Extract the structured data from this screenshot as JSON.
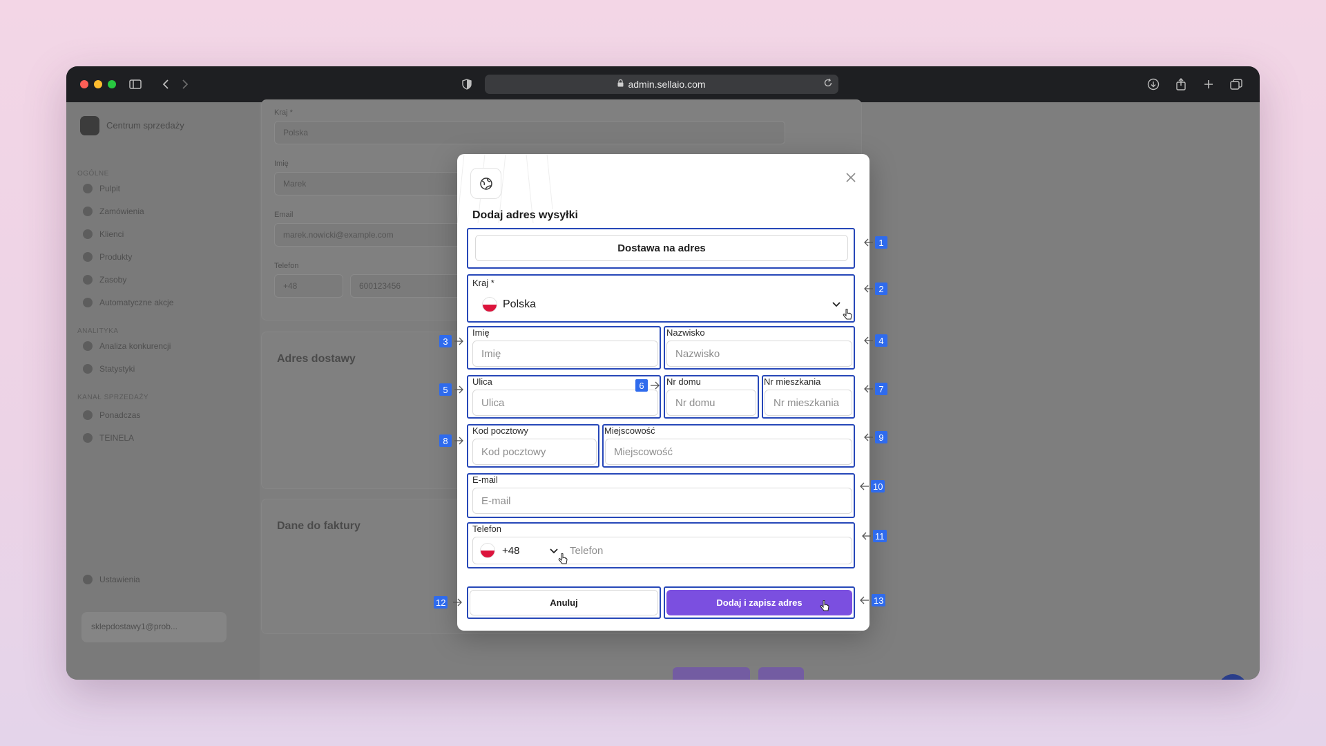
{
  "browser": {
    "url": "admin.sellaio.com"
  },
  "background_app": {
    "brand": "Centrum sprzedaży",
    "sections": [
      "OGÓLNE",
      "ANALITYKA",
      "KANAŁ SPRZEDAŻY"
    ],
    "nav": [
      "Pulpit",
      "Zamówienia",
      "Klienci",
      "Produkty",
      "Zasoby",
      "Automatyczne akcje",
      "Analiza konkurencji",
      "Statystyki",
      "Ponadczas",
      "TEINELA"
    ],
    "settings": "Ustawienia",
    "user_email": "sklepdostawy1@prob...",
    "fields": {
      "country_label": "Kraj *",
      "country_value": "Polska",
      "name_label": "Imię",
      "name_value": "Marek",
      "email_label": "Email",
      "email_value": "marek.nowicki@example.com",
      "phone_label": "Telefon",
      "phone_prefix": "+48",
      "phone_value": "600123456"
    },
    "headings": {
      "delivery_address": "Adres dostawy",
      "invoice_data": "Dane do faktury"
    }
  },
  "modal": {
    "title": "Dodaj adres wysyłki",
    "delivery_option": "Dostawa na adres",
    "country": {
      "label": "Kraj *",
      "value": "Polska"
    },
    "first_name": {
      "label": "Imię",
      "placeholder": "Imię"
    },
    "last_name": {
      "label": "Nazwisko",
      "placeholder": "Nazwisko"
    },
    "street": {
      "label": "Ulica",
      "placeholder": "Ulica"
    },
    "house_no": {
      "label": "Nr domu",
      "placeholder": "Nr domu"
    },
    "apartment_no": {
      "label": "Nr mieszkania",
      "placeholder": "Nr mieszkania"
    },
    "postal_code": {
      "label": "Kod pocztowy",
      "placeholder": "Kod pocztowy"
    },
    "city": {
      "label": "Miejscowość",
      "placeholder": "Miejscowość"
    },
    "email": {
      "label": "E-mail",
      "placeholder": "E-mail"
    },
    "phone": {
      "label": "Telefon",
      "prefix": "+48",
      "placeholder": "Telefon"
    },
    "cancel_label": "Anuluj",
    "submit_label": "Dodaj i zapisz adres"
  },
  "annotations": [
    "1",
    "2",
    "3",
    "4",
    "5",
    "6",
    "7",
    "8",
    "9",
    "10",
    "11",
    "12",
    "13"
  ],
  "colors": {
    "accent": "#7b4fe0",
    "annotation": "#2f6bed",
    "highlight": "#2647b8"
  }
}
